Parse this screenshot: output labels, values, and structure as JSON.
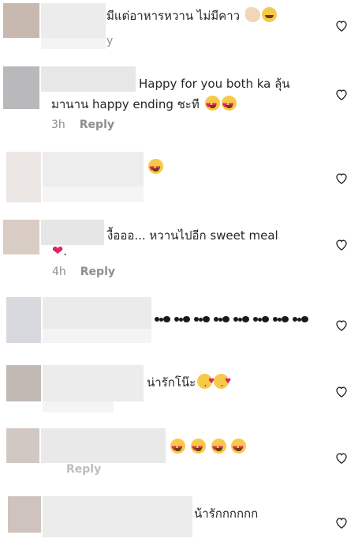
{
  "comments": [
    {
      "text": "มีแต่อาหารหวาน ไม่มีคาว",
      "emojis": [
        "clap",
        "smile"
      ],
      "meta_time": "",
      "meta_reply": "y"
    },
    {
      "text": "Happy for you both ka ลุ้น",
      "text2": "มานาน happy ending ชะที",
      "emojis": [
        "hearteyes",
        "hearteyes"
      ],
      "meta_time": "3h",
      "meta_reply": "Reply"
    },
    {
      "text": "",
      "emojis": [
        "hearteyes"
      ],
      "meta_time": "",
      "meta_reply": ""
    },
    {
      "text": "งื้อออ... หวานไปอีก sweet meal",
      "text2": ".",
      "emojis": [
        "redheart"
      ],
      "meta_time": "4h",
      "meta_reply": "Reply"
    },
    {
      "text": "",
      "emojis": [
        "ant",
        "ant",
        "ant",
        "ant",
        "ant",
        "ant",
        "ant",
        "ant"
      ],
      "meta_time": "",
      "meta_reply": ""
    },
    {
      "text": "น่ารักโน๊ะ",
      "emojis": [
        "kiss",
        "kiss"
      ],
      "meta_time": "",
      "meta_reply": ""
    },
    {
      "text": "",
      "emojis": [
        "hearteyes",
        "hearteyes",
        "hearteyes",
        "hearteyes"
      ],
      "meta_time": "",
      "meta_reply": "Reply"
    },
    {
      "text": "น้ารักกกกกก",
      "emojis": [],
      "meta_time": "",
      "meta_reply": ""
    }
  ],
  "colors": {
    "heart_stroke": "#262626",
    "meta": "#8e8e8e",
    "pixelation": [
      "#c9bdb5",
      "#e9e9e9",
      "#f3f3f3",
      "#d7d9de"
    ]
  },
  "icons": {
    "like": "heart-outline-icon"
  }
}
